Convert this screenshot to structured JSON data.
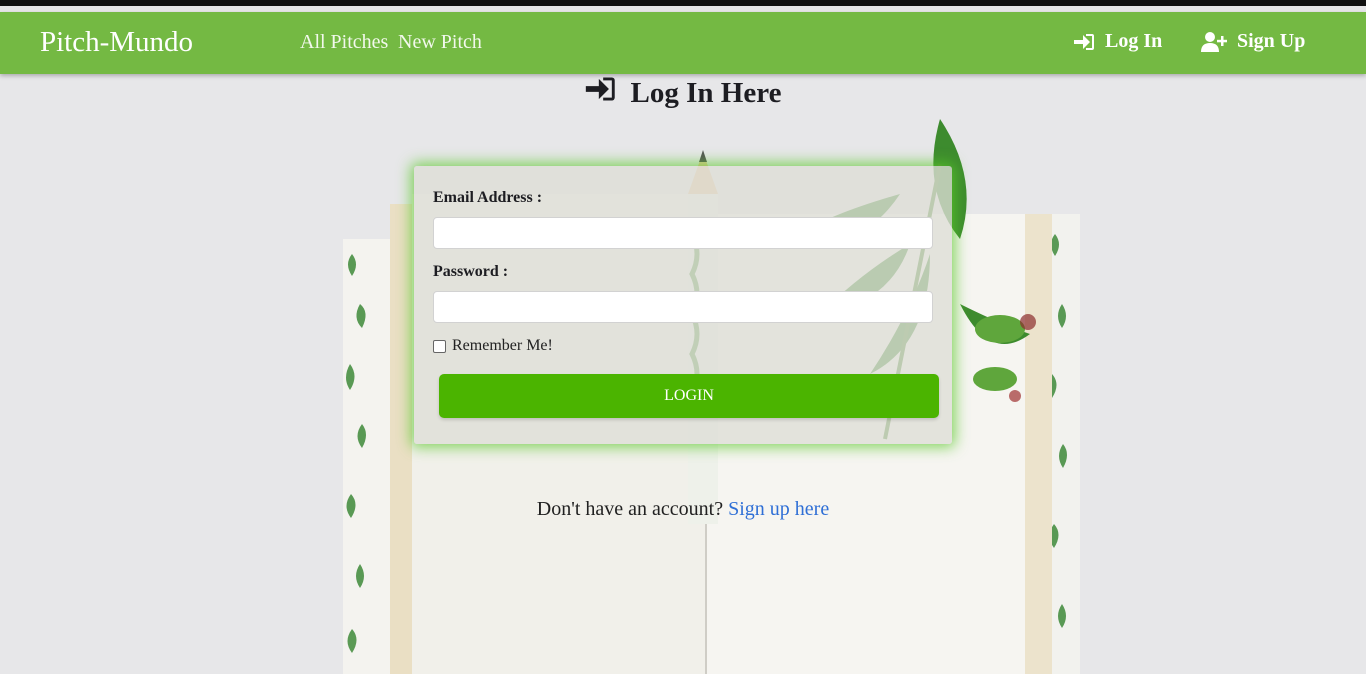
{
  "navbar": {
    "brand": "Pitch-Mundo",
    "links": [
      "All Pitches",
      "New Pitch"
    ],
    "login_label": "Log In",
    "signup_label": "Sign Up",
    "color": "#74b943"
  },
  "page": {
    "title": "Log In Here"
  },
  "form": {
    "email_label": "Email Address :",
    "email_value": "",
    "password_label": "Password :",
    "password_value": "",
    "remember_label": "Remember Me!",
    "remember_checked": false,
    "submit_label": "LOGIN",
    "button_color": "#4bb400"
  },
  "footer": {
    "prompt": "Don't have an account?",
    "link": "Sign up here"
  },
  "icons": {
    "login": "sign-in-icon",
    "signup": "user-plus-icon"
  }
}
